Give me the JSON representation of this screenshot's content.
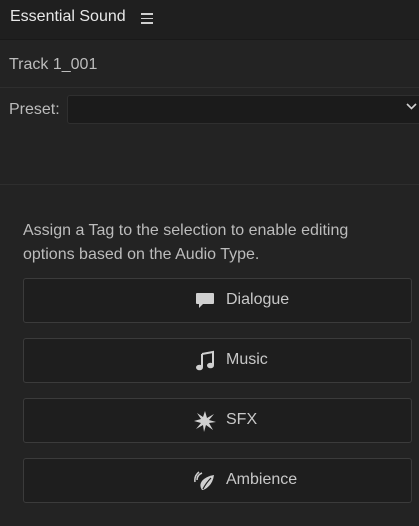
{
  "panel": {
    "title": "Essential Sound",
    "menu_icon": "hamburger-menu-icon"
  },
  "clip": {
    "name": "Track 1_001"
  },
  "preset": {
    "label": "Preset:",
    "value": "",
    "icon": "chevron-down-icon"
  },
  "instructions": "Assign a Tag to the selection to enable editing options based on the Audio Type.",
  "tags": [
    {
      "label": "Dialogue",
      "icon": "speech-bubble-icon"
    },
    {
      "label": "Music",
      "icon": "music-note-icon"
    },
    {
      "label": "SFX",
      "icon": "burst-icon"
    },
    {
      "label": "Ambience",
      "icon": "ambience-leaf-icon"
    }
  ],
  "colors": {
    "background": "#232323",
    "button_background": "#1e1e1e",
    "text": "#bcbcbc",
    "icon": "#d0d0d0"
  }
}
